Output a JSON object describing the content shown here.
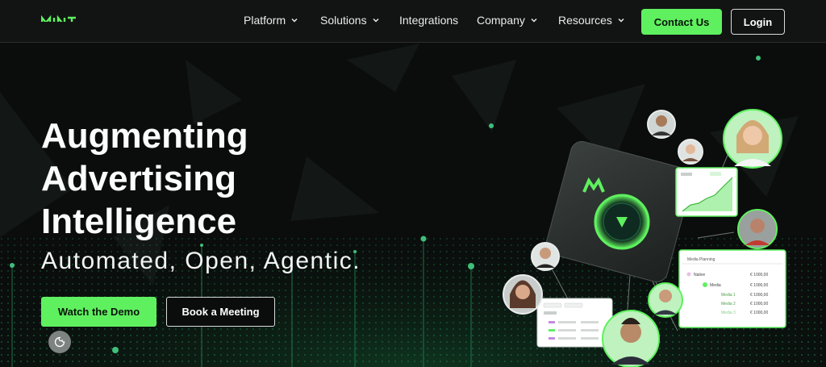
{
  "brand": {
    "logo_text": "MINT"
  },
  "nav": {
    "items": [
      {
        "label": "Platform",
        "dropdown": true
      },
      {
        "label": "Solutions",
        "dropdown": true
      },
      {
        "label": "Integrations",
        "dropdown": false
      },
      {
        "label": "Company",
        "dropdown": true
      },
      {
        "label": "Resources",
        "dropdown": true
      }
    ],
    "contact_label": "Contact Us",
    "login_label": "Login"
  },
  "hero": {
    "headline": [
      "Augmenting",
      "Advertising",
      "Intelligence"
    ],
    "subheadline": "Automated, Open, Agentic.",
    "primary_cta": "Watch the Demo",
    "secondary_cta": "Book a Meeting"
  },
  "media_planning_card": {
    "title": "Media Planning",
    "rows": [
      {
        "label": "Native",
        "value": "€ 1000,00"
      },
      {
        "label": "Media",
        "value": "€ 1000,00"
      },
      {
        "label": "Media 1",
        "value": "€ 1000,00"
      },
      {
        "label": "Media 2",
        "value": "€ 1000,00"
      },
      {
        "label": "Media 3",
        "value": "€ 1000,00"
      }
    ]
  },
  "colors": {
    "accent": "#5ff05f",
    "background": "#0a0d0c",
    "header": "#121413",
    "card": "#ffffff"
  },
  "icons": {
    "nav_dropdown": "chevron-down-icon",
    "cookie": "cookie-settings-icon",
    "play": "play-icon"
  }
}
